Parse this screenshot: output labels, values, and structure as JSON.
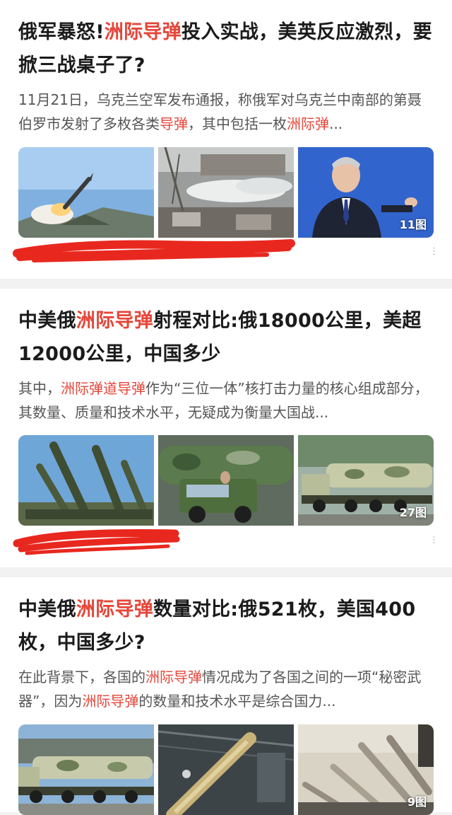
{
  "feed": {
    "cards": [
      {
        "title": [
          "俄军暴怒!",
          "洲际导弹",
          "投入实战，美英反应激烈，要掀三战桌子了?"
        ],
        "summary": [
          "11月21日，乌克兰空军发布通报，称俄军对乌克兰中南部的第聂伯罗市发射了多枚各类",
          "导弹",
          "，其中包括一枚",
          "洲际弹",
          "..."
        ],
        "image_count": "11图"
      },
      {
        "title": [
          "中美俄",
          "洲际导弹",
          "射程对比:俄18000公里，美超12000公里，中国多少"
        ],
        "summary": [
          "其中，",
          "洲际弹道导弹",
          "作为“三位一体”核打击力量的核心组成部分，其数量、质量和技术水平，无疑成为衡量大国战..."
        ],
        "image_count": "27图"
      },
      {
        "title": [
          "中美俄",
          "洲际导弹",
          "数量对比:俄521枚，美国400枚，中国多少?"
        ],
        "summary": [
          "在此背景下，各国的",
          "洲际导弹",
          "情况成为了各国之间的一项“秘密武器”，因为",
          "洲际导弹",
          "的数量和技术水平是综合国力..."
        ],
        "image_count": "9图"
      }
    ]
  },
  "colors": {
    "highlight": "#e5463a",
    "background": "#f2f2f2",
    "card": "#ffffff",
    "scribble": "#e8281f"
  }
}
